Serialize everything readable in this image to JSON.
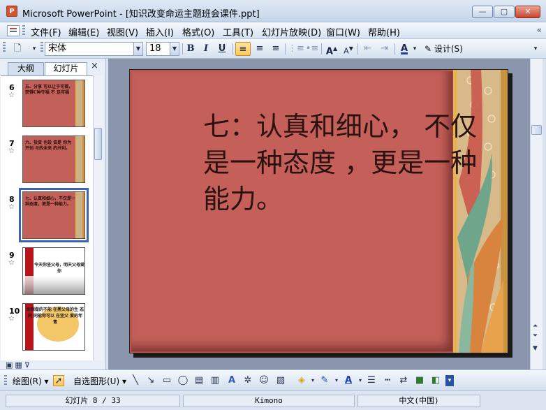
{
  "window": {
    "title": "Microsoft PowerPoint - [知识改变命运主题班会课件.ppt]",
    "app_icon": "P"
  },
  "menu": {
    "items": [
      "文件(F)",
      "编辑(E)",
      "视图(V)",
      "插入(I)",
      "格式(O)",
      "工具(T)",
      "幻灯片放映(D)",
      "窗口(W)",
      "帮助(H)"
    ]
  },
  "toolbar": {
    "font": "宋体",
    "size": "18",
    "bold": "B",
    "italic": "I",
    "underline": "U",
    "design_label": "设计(S)"
  },
  "panel": {
    "tab_outline": "大纲",
    "tab_slides": "幻灯片",
    "close": "×",
    "thumbnails": [
      {
        "num": "6",
        "text": "五、分享 可以让于可福，获得C种守福 不 足可福"
      },
      {
        "num": "7",
        "text": "六、投资 也投 资是 你为开创 与的未来 的并利。"
      },
      {
        "num": "8",
        "text": "七、认真和细心，不仅是一种态度，更是一种能力。"
      },
      {
        "num": "9",
        "text": "今天你坚父母，明天父母爱你"
      },
      {
        "num": "10",
        "text": "你想做的不能 在黑父母的生 态 同 同能你可以 在坚父 爱的年 青"
      }
    ]
  },
  "slide": {
    "title": "七：认真和细心，  不仅是一种态度  ，更是一种能力。"
  },
  "drawbar": {
    "draw": "绘图(R)",
    "autoshapes": "自选图形(U)"
  },
  "status": {
    "slide_pos": "幻灯片 8 / 33",
    "theme": "Kimono",
    "language": "中文(中国)"
  },
  "colors": {
    "slide_bg": "#c55f5a",
    "accent": "#3b64b0"
  }
}
